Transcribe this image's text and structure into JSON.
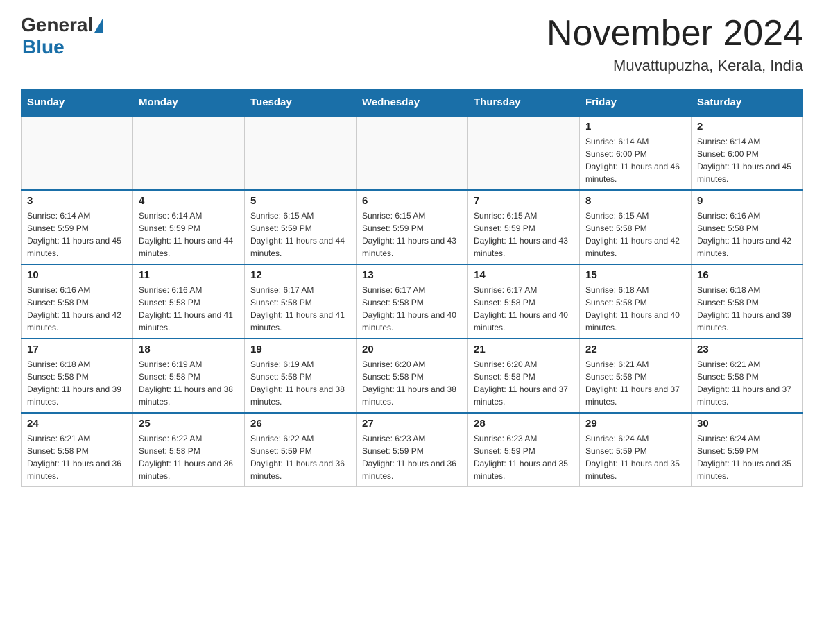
{
  "header": {
    "logo": {
      "general": "General",
      "blue": "Blue"
    },
    "title": "November 2024",
    "subtitle": "Muvattupuzha, Kerala, India"
  },
  "days_of_week": [
    "Sunday",
    "Monday",
    "Tuesday",
    "Wednesday",
    "Thursday",
    "Friday",
    "Saturday"
  ],
  "weeks": [
    [
      {
        "day": "",
        "info": ""
      },
      {
        "day": "",
        "info": ""
      },
      {
        "day": "",
        "info": ""
      },
      {
        "day": "",
        "info": ""
      },
      {
        "day": "",
        "info": ""
      },
      {
        "day": "1",
        "info": "Sunrise: 6:14 AM\nSunset: 6:00 PM\nDaylight: 11 hours and 46 minutes."
      },
      {
        "day": "2",
        "info": "Sunrise: 6:14 AM\nSunset: 6:00 PM\nDaylight: 11 hours and 45 minutes."
      }
    ],
    [
      {
        "day": "3",
        "info": "Sunrise: 6:14 AM\nSunset: 5:59 PM\nDaylight: 11 hours and 45 minutes."
      },
      {
        "day": "4",
        "info": "Sunrise: 6:14 AM\nSunset: 5:59 PM\nDaylight: 11 hours and 44 minutes."
      },
      {
        "day": "5",
        "info": "Sunrise: 6:15 AM\nSunset: 5:59 PM\nDaylight: 11 hours and 44 minutes."
      },
      {
        "day": "6",
        "info": "Sunrise: 6:15 AM\nSunset: 5:59 PM\nDaylight: 11 hours and 43 minutes."
      },
      {
        "day": "7",
        "info": "Sunrise: 6:15 AM\nSunset: 5:59 PM\nDaylight: 11 hours and 43 minutes."
      },
      {
        "day": "8",
        "info": "Sunrise: 6:15 AM\nSunset: 5:58 PM\nDaylight: 11 hours and 42 minutes."
      },
      {
        "day": "9",
        "info": "Sunrise: 6:16 AM\nSunset: 5:58 PM\nDaylight: 11 hours and 42 minutes."
      }
    ],
    [
      {
        "day": "10",
        "info": "Sunrise: 6:16 AM\nSunset: 5:58 PM\nDaylight: 11 hours and 42 minutes."
      },
      {
        "day": "11",
        "info": "Sunrise: 6:16 AM\nSunset: 5:58 PM\nDaylight: 11 hours and 41 minutes."
      },
      {
        "day": "12",
        "info": "Sunrise: 6:17 AM\nSunset: 5:58 PM\nDaylight: 11 hours and 41 minutes."
      },
      {
        "day": "13",
        "info": "Sunrise: 6:17 AM\nSunset: 5:58 PM\nDaylight: 11 hours and 40 minutes."
      },
      {
        "day": "14",
        "info": "Sunrise: 6:17 AM\nSunset: 5:58 PM\nDaylight: 11 hours and 40 minutes."
      },
      {
        "day": "15",
        "info": "Sunrise: 6:18 AM\nSunset: 5:58 PM\nDaylight: 11 hours and 40 minutes."
      },
      {
        "day": "16",
        "info": "Sunrise: 6:18 AM\nSunset: 5:58 PM\nDaylight: 11 hours and 39 minutes."
      }
    ],
    [
      {
        "day": "17",
        "info": "Sunrise: 6:18 AM\nSunset: 5:58 PM\nDaylight: 11 hours and 39 minutes."
      },
      {
        "day": "18",
        "info": "Sunrise: 6:19 AM\nSunset: 5:58 PM\nDaylight: 11 hours and 38 minutes."
      },
      {
        "day": "19",
        "info": "Sunrise: 6:19 AM\nSunset: 5:58 PM\nDaylight: 11 hours and 38 minutes."
      },
      {
        "day": "20",
        "info": "Sunrise: 6:20 AM\nSunset: 5:58 PM\nDaylight: 11 hours and 38 minutes."
      },
      {
        "day": "21",
        "info": "Sunrise: 6:20 AM\nSunset: 5:58 PM\nDaylight: 11 hours and 37 minutes."
      },
      {
        "day": "22",
        "info": "Sunrise: 6:21 AM\nSunset: 5:58 PM\nDaylight: 11 hours and 37 minutes."
      },
      {
        "day": "23",
        "info": "Sunrise: 6:21 AM\nSunset: 5:58 PM\nDaylight: 11 hours and 37 minutes."
      }
    ],
    [
      {
        "day": "24",
        "info": "Sunrise: 6:21 AM\nSunset: 5:58 PM\nDaylight: 11 hours and 36 minutes."
      },
      {
        "day": "25",
        "info": "Sunrise: 6:22 AM\nSunset: 5:58 PM\nDaylight: 11 hours and 36 minutes."
      },
      {
        "day": "26",
        "info": "Sunrise: 6:22 AM\nSunset: 5:59 PM\nDaylight: 11 hours and 36 minutes."
      },
      {
        "day": "27",
        "info": "Sunrise: 6:23 AM\nSunset: 5:59 PM\nDaylight: 11 hours and 36 minutes."
      },
      {
        "day": "28",
        "info": "Sunrise: 6:23 AM\nSunset: 5:59 PM\nDaylight: 11 hours and 35 minutes."
      },
      {
        "day": "29",
        "info": "Sunrise: 6:24 AM\nSunset: 5:59 PM\nDaylight: 11 hours and 35 minutes."
      },
      {
        "day": "30",
        "info": "Sunrise: 6:24 AM\nSunset: 5:59 PM\nDaylight: 11 hours and 35 minutes."
      }
    ]
  ]
}
